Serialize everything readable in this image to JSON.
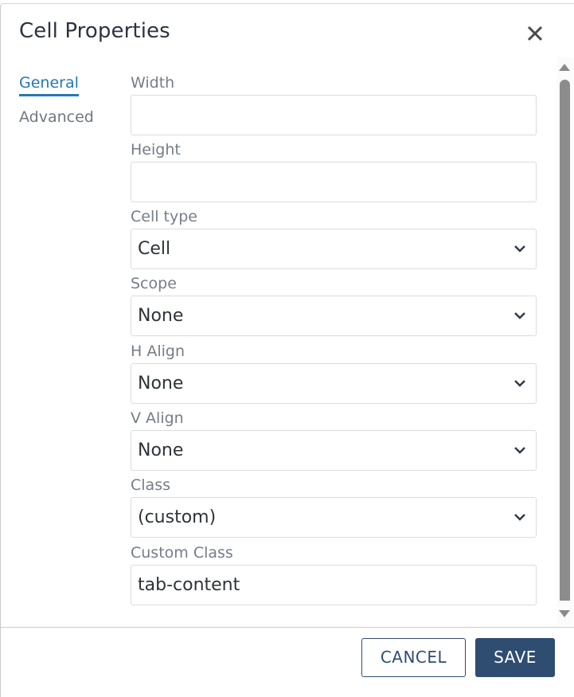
{
  "dialog": {
    "title": "Cell Properties",
    "close_icon": "close-icon"
  },
  "tabs": [
    {
      "label": "General",
      "active": true
    },
    {
      "label": "Advanced",
      "active": false
    }
  ],
  "fields": {
    "width": {
      "label": "Width",
      "value": ""
    },
    "height": {
      "label": "Height",
      "value": ""
    },
    "cell_type": {
      "label": "Cell type",
      "value": "Cell"
    },
    "scope": {
      "label": "Scope",
      "value": "None"
    },
    "h_align": {
      "label": "H Align",
      "value": "None"
    },
    "v_align": {
      "label": "V Align",
      "value": "None"
    },
    "class": {
      "label": "Class",
      "value": "(custom)"
    },
    "custom_class": {
      "label": "Custom Class",
      "value": "tab-content"
    }
  },
  "footer": {
    "cancel_label": "CANCEL",
    "save_label": "SAVE"
  },
  "colors": {
    "accent": "#2478b5",
    "primary_button": "#2f4d70",
    "title_text": "#2b3440",
    "label_text": "#747d87"
  }
}
